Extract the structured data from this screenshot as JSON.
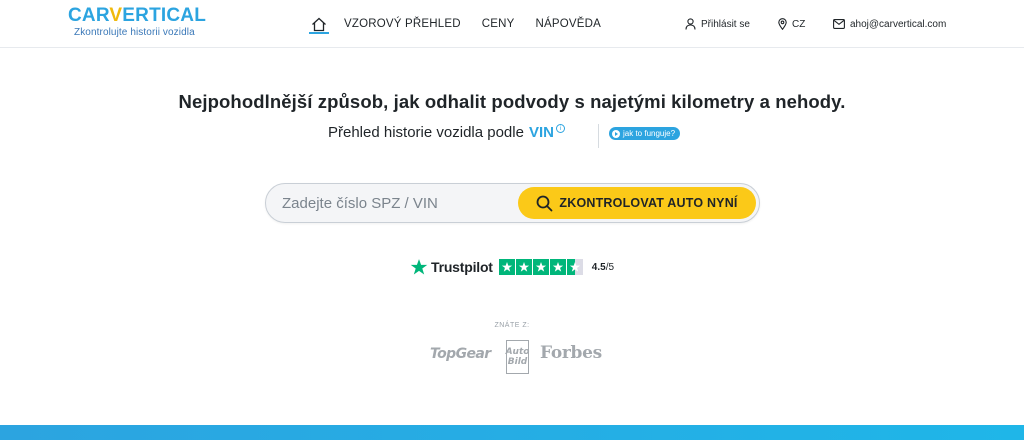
{
  "header": {
    "logo_car": "CAR",
    "logo_v": "V",
    "logo_rest": "ERTICAL",
    "tagline": "Zkontrolujte historii vozidla",
    "nav": [
      {
        "label": "VZOROVÝ PŘEHLED"
      },
      {
        "label": "CENY"
      },
      {
        "label": "NÁPOVĚDA"
      }
    ],
    "login_label": "Přihlásit se",
    "country": "CZ",
    "email": "ahoj@carvertical.com",
    "home_icon": "home-icon",
    "user_icon": "user-icon",
    "location_icon": "location-pin-icon",
    "mail_icon": "mail-icon"
  },
  "hero": {
    "headline": "Nejpohodlnější způsob, jak odhalit podvody s najetými kilometry a nehody.",
    "subline": "Přehled historie vozidla podle",
    "vin": "VIN",
    "vin_info": "i",
    "how_it_works": "jak to funguje?"
  },
  "search": {
    "placeholder": "Zadejte číslo SPZ / VIN",
    "button_label": "ZKONTROLOVAT AUTO NYNÍ"
  },
  "trustpilot": {
    "name": "Trustpilot",
    "score": "4.5",
    "max": "/5",
    "rating": 4.5
  },
  "press": {
    "title": "ZNÁTE Z:",
    "topgear": "TopGear",
    "autobild_top": "Auto",
    "autobild_bottom": "Bild",
    "forbes": "Forbes"
  },
  "colors": {
    "brand_blue": "#2ca4e0",
    "brand_yellow": "#fbc918",
    "trustpilot_green": "#00b67a"
  }
}
